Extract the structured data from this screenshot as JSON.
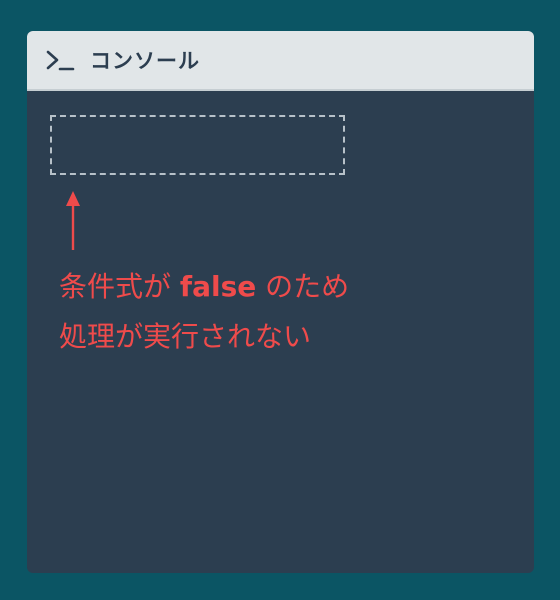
{
  "console": {
    "icon": "terminal-icon",
    "title": "コンソール"
  },
  "annotation": {
    "line1_before": "条件式が ",
    "keyword": "false",
    "line1_after": " のため",
    "line2": "処理が実行されない"
  },
  "colors": {
    "background": "#0b5564",
    "console_body": "#2c3e50",
    "console_header": "#e1e6e8",
    "annotation": "#ef4b4b",
    "dashed_box": "#b7c1c9"
  }
}
